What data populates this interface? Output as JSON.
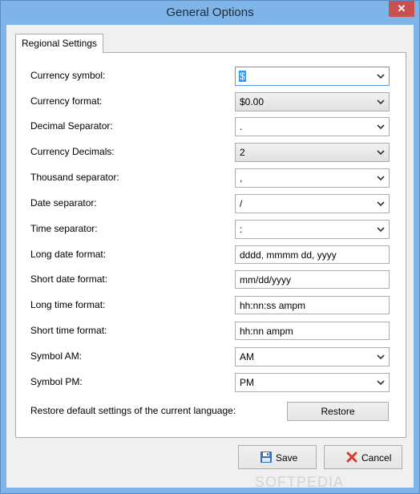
{
  "window": {
    "title": "General Options",
    "close_glyph": "✕"
  },
  "tabs": [
    {
      "label": "Regional Settings"
    }
  ],
  "fields": [
    {
      "label": "Currency symbol:",
      "value": "$",
      "type": "combo"
    },
    {
      "label": "Currency format:",
      "value": "$0.00",
      "type": "combo"
    },
    {
      "label": "Decimal Separator:",
      "value": ".",
      "type": "combo"
    },
    {
      "label": "Currency Decimals:",
      "value": "2",
      "type": "combo"
    },
    {
      "label": "Thousand separator:",
      "value": ",",
      "type": "combo"
    },
    {
      "label": "Date separator:",
      "value": "/",
      "type": "combo"
    },
    {
      "label": "Time separator:",
      "value": ":",
      "type": "combo"
    },
    {
      "label": "Long date format:",
      "value": "dddd, mmmm dd, yyyy",
      "type": "text"
    },
    {
      "label": "Short date format:",
      "value": "mm/dd/yyyy",
      "type": "text"
    },
    {
      "label": "Long time format:",
      "value": "hh:nn:ss ampm",
      "type": "text"
    },
    {
      "label": "Short time format:",
      "value": "hh:nn ampm",
      "type": "text"
    },
    {
      "label": "Symbol AM:",
      "value": "AM",
      "type": "combo"
    },
    {
      "label": "Symbol PM:",
      "value": "PM",
      "type": "combo"
    }
  ],
  "restore": {
    "label": "Restore default settings of the current language:",
    "button": "Restore"
  },
  "buttons": {
    "save": "Save",
    "cancel": "Cancel"
  },
  "icons": {
    "save": "floppy-disk-icon",
    "cancel": "red-x-icon",
    "dropdown": "chevron-down-icon"
  },
  "watermark": "SOFTPEDIA",
  "colors": {
    "titlebar": "#7eb4e8",
    "close": "#c75050",
    "selection": "#3399ff"
  }
}
